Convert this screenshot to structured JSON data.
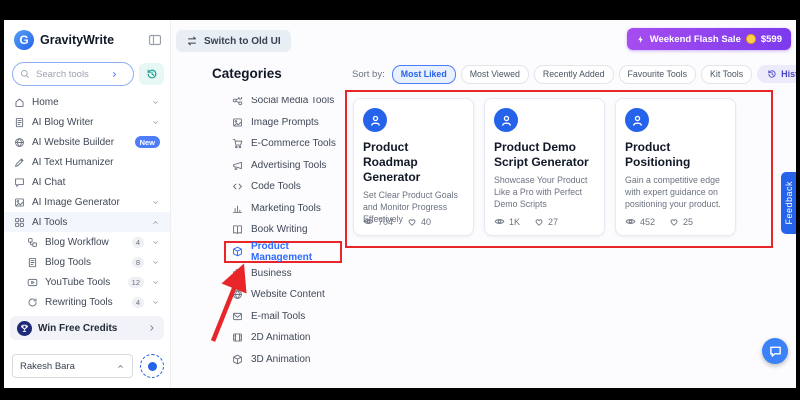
{
  "brand": {
    "name": "GravityWrite"
  },
  "topbar": {
    "switch_old_ui": "Switch to Old UI",
    "flash_sale_label": "Weekend Flash Sale",
    "flash_sale_price": "$599"
  },
  "sidebar": {
    "search_placeholder": "Search tools",
    "nav": [
      {
        "label": "Home"
      },
      {
        "label": "AI Blog Writer"
      },
      {
        "label": "AI Website Builder",
        "badge": "New"
      },
      {
        "label": "AI Text Humanizer"
      },
      {
        "label": "AI Chat"
      },
      {
        "label": "AI Image Generator"
      },
      {
        "label": "AI Tools"
      }
    ],
    "ai_tools_children": [
      {
        "label": "Blog Workflow",
        "count": "4"
      },
      {
        "label": "Blog Tools",
        "count": "8"
      },
      {
        "label": "YouTube Tools",
        "count": "12"
      },
      {
        "label": "Rewriting Tools",
        "count": "4"
      }
    ],
    "win_free_credits": "Win Free Credits",
    "user_name": "Rakesh Bara"
  },
  "categories": {
    "title": "Categories",
    "items": [
      "Social Media Tools",
      "Image Prompts",
      "E-Commerce Tools",
      "Advertising Tools",
      "Code Tools",
      "Marketing Tools",
      "Book Writing",
      "Product Management",
      "Business",
      "Website Content",
      "E-mail Tools",
      "2D Animation",
      "3D Animation"
    ],
    "active_item": "Product Management"
  },
  "toolbar": {
    "sort_by_label": "Sort by:",
    "filters": [
      "Most Liked",
      "Most Viewed",
      "Recently Added",
      "Favourite Tools",
      "Kit Tools"
    ],
    "active_filter": "Most Liked",
    "history_label": "History"
  },
  "cards": [
    {
      "title": "Product Roadmap Generator",
      "description": "Set Clear Product Goals and Monitor Progress Effectively",
      "views": "704",
      "likes": "40"
    },
    {
      "title": "Product Demo Script Generator",
      "description": "Showcase Your Product Like a Pro with Perfect Demo Scripts",
      "views": "1K",
      "likes": "27"
    },
    {
      "title": "Product Positioning",
      "description": "Gain a competitive edge with expert guidance on positioning your product.",
      "views": "452",
      "likes": "25"
    }
  ],
  "feedback_label": "Feedback",
  "colors": {
    "accent_blue": "#2563eb",
    "sale_purple": "#7c3aed",
    "annotation_red": "#e8262a",
    "teal": "#0d9488"
  }
}
